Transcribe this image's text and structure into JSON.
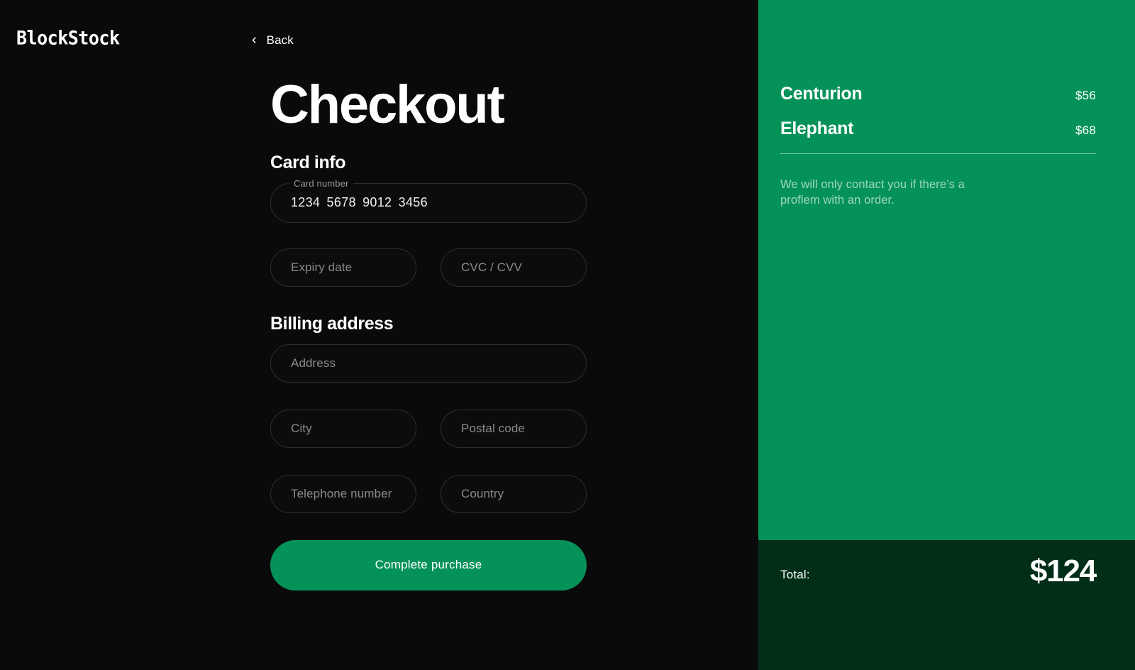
{
  "brand": {
    "logo_text": "BlockStock"
  },
  "nav": {
    "back_label": "Back",
    "back_icon": "chevron-left-icon"
  },
  "main": {
    "page_title": "Checkout",
    "card_section": {
      "title": "Card info",
      "card_number": {
        "label": "Card number",
        "value": "1234  5678  9012  3456"
      },
      "expiry": {
        "placeholder": "Expiry date",
        "value": ""
      },
      "cvc": {
        "placeholder": "CVC / CVV",
        "value": ""
      }
    },
    "billing_section": {
      "title": "Billing address",
      "address": {
        "placeholder": "Address",
        "value": ""
      },
      "city": {
        "placeholder": "City",
        "value": ""
      },
      "postal_code": {
        "placeholder": "Postal code",
        "value": ""
      },
      "telephone": {
        "placeholder": "Telephone number",
        "value": ""
      },
      "country": {
        "placeholder": "Country",
        "value": ""
      }
    },
    "submit_label": "Complete purchase"
  },
  "summary": {
    "items": [
      {
        "name": "Centurion",
        "price": "$56"
      },
      {
        "name": "Elephant",
        "price": "$68"
      }
    ],
    "note": "We will only contact you if there’s a proflem with an order.",
    "total_label": "Total:",
    "total_value": "$124"
  },
  "colors": {
    "background": "#0a0a0a",
    "accent_green": "#059259",
    "total_green": "#022e18",
    "field_border": "#2e2e2e",
    "placeholder": "#8a8a8a",
    "text": "#ffffff"
  }
}
